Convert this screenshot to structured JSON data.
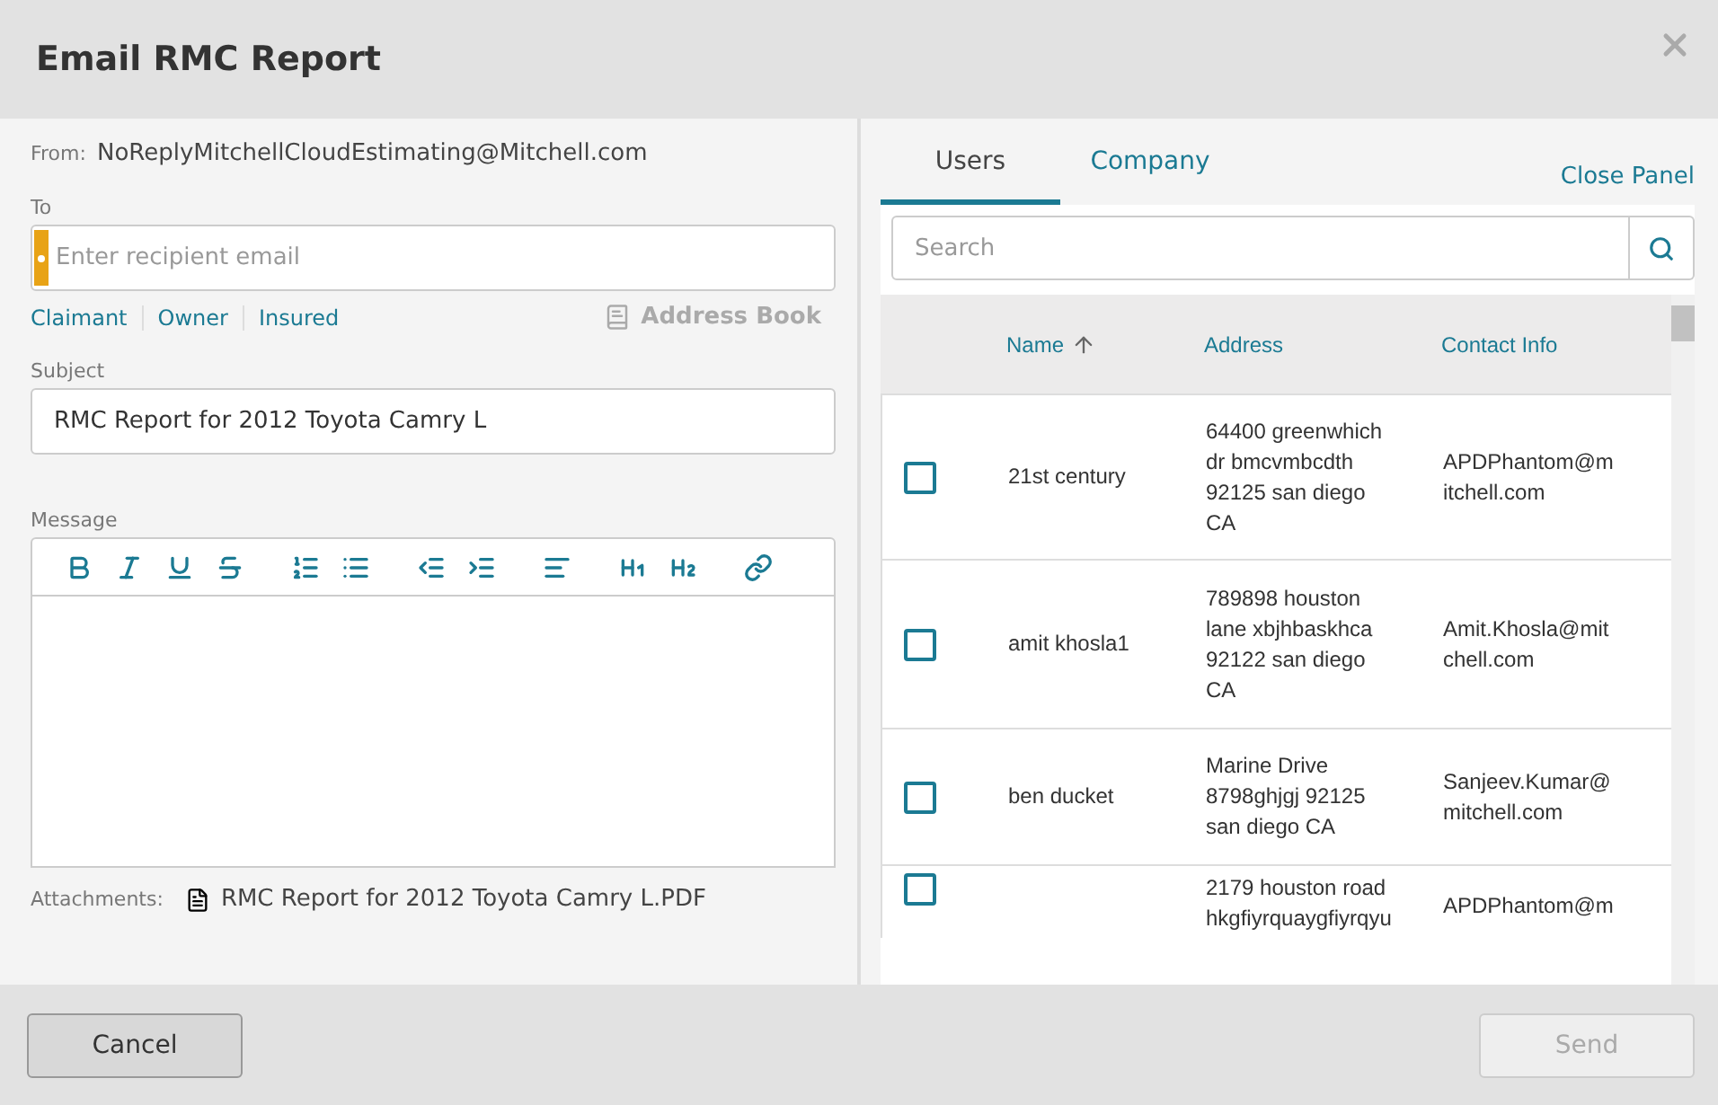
{
  "dialog": {
    "title": "Email RMC Report"
  },
  "from": {
    "label": "From:",
    "value": "NoReplyMitchellCloudEstimating@Mitchell.com"
  },
  "to": {
    "label": "To",
    "placeholder": "Enter recipient email",
    "required": true
  },
  "quick_recipients": [
    "Claimant",
    "Owner",
    "Insured"
  ],
  "address_book": {
    "label": "Address Book",
    "disabled": true
  },
  "subject": {
    "label": "Subject",
    "value": "RMC Report for 2012 Toyota Camry L"
  },
  "message": {
    "label": "Message"
  },
  "attachments": {
    "label": "Attachments:",
    "files": [
      "RMC Report for 2012 Toyota Camry L.PDF"
    ]
  },
  "panel": {
    "tabs": [
      {
        "label": "Users",
        "selected": true
      },
      {
        "label": "Company",
        "selected": false
      }
    ],
    "close_label": "Close Panel",
    "search": {
      "placeholder": "Search"
    },
    "table": {
      "columns": [
        {
          "label": "Name",
          "sorted": true
        },
        {
          "label": "Address",
          "sorted": false
        },
        {
          "label": "Contact Info",
          "sorted": false
        }
      ],
      "rows": [
        {
          "checked": false,
          "name": "21st century",
          "address": "64400 greenwhich dr bmcvmbcdth 92125 san diego CA",
          "contact": "APDPhantom@mitchell.com"
        },
        {
          "checked": false,
          "name": "amit khosla1",
          "address": "789898 houston lane xbjhbaskhca 92122 san diego CA",
          "contact": "Amit.Khosla@mitchell.com"
        },
        {
          "checked": false,
          "name": "ben ducket",
          "address": "Marine Drive 8798ghjgj 92125 san diego CA",
          "contact": "Sanjeev.Kumar@mitchell.com"
        },
        {
          "checked": false,
          "address": "2179 houston road hkgfiyrquaygfiyrqyu",
          "contact": "APDPhantom@m"
        }
      ]
    }
  },
  "buttons": [
    {
      "label": "Cancel",
      "disabled": false
    },
    {
      "label": "Send",
      "disabled": true
    }
  ]
}
